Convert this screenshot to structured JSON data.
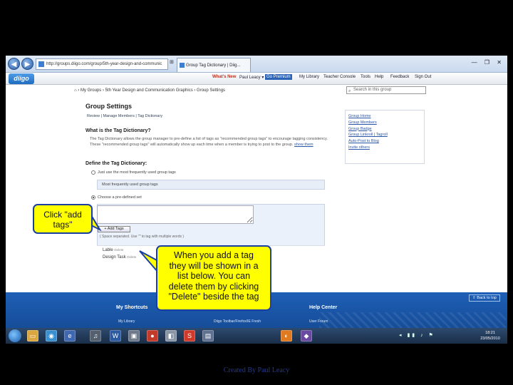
{
  "browser": {
    "address": "http://groups.diigo.com/group/5th-year-design-and-communic",
    "tab_title": "Group Tag Dictionary | Diig...",
    "window_controls": "— ❐ ✕"
  },
  "diigo_toolbar": {
    "logo": "diigo",
    "whats_new": "What's New",
    "user": "Paul Leacy ▾",
    "premium": "Go Premium",
    "items": [
      "My Library",
      "Teacher Console",
      "Tools",
      "Help",
      "Feedback",
      "Sign Out"
    ]
  },
  "breadcrumb": "⌂  ›  My Groups  ›  5th Year Design and Communication Graphics  ›  Group Settings",
  "search": {
    "placeholder": "Search in this group"
  },
  "main": {
    "title": "Group Settings",
    "subnav": "Review   |   Manage Members   |   Tag Dictionary",
    "section1_title": "What is the Tag Dictionary?",
    "description": "The Tag Dictionary allows the group manager to pre-define a list of tags as \"recommended group tags\" to encourage tagging consistency. These \"recommended group tags\" will automatically show up each time when a member is trying to post to the group.",
    "description_link": "show them",
    "section2_title": "Define the Tag Dictionary:",
    "option1": "Just use the most frequently used group tags",
    "most_frequent": "Most frequently used group tags",
    "option2": "Choose a pre-defined set",
    "add_tags_button": "+ Add Tags",
    "hint": "( Space separated. Use \"\" to tag with multiple words )",
    "tags": [
      {
        "name": "Lable",
        "action": "Delete"
      },
      {
        "name": "Design Task",
        "action": "Delete"
      }
    ]
  },
  "sidebar": {
    "links": [
      "Group Home",
      "Group Members",
      "Group Badge",
      "Group Linkroll | Tagroll",
      "Auto-Post to Blog",
      "Invite others"
    ]
  },
  "footer": {
    "back_to_top": "⇧ Back to top",
    "shortcuts_title": "My Shortcuts",
    "help_title": "Help Center",
    "links": [
      "My Library",
      "Diigo Toolbar/Firefox/IE Fresh",
      "User Forum"
    ]
  },
  "taskbar": {
    "time": "18:21",
    "date": "23/05/2010"
  },
  "callouts": {
    "add_tags_lines": [
      "Click \"add",
      "tags\""
    ],
    "tag_info_lines": [
      "When you add a tag",
      "they will be shown in a",
      "list below. You can",
      "delete them by clicking",
      "\"Delete\" beside the tag"
    ]
  },
  "credit": "Created By Paul Leacy"
}
